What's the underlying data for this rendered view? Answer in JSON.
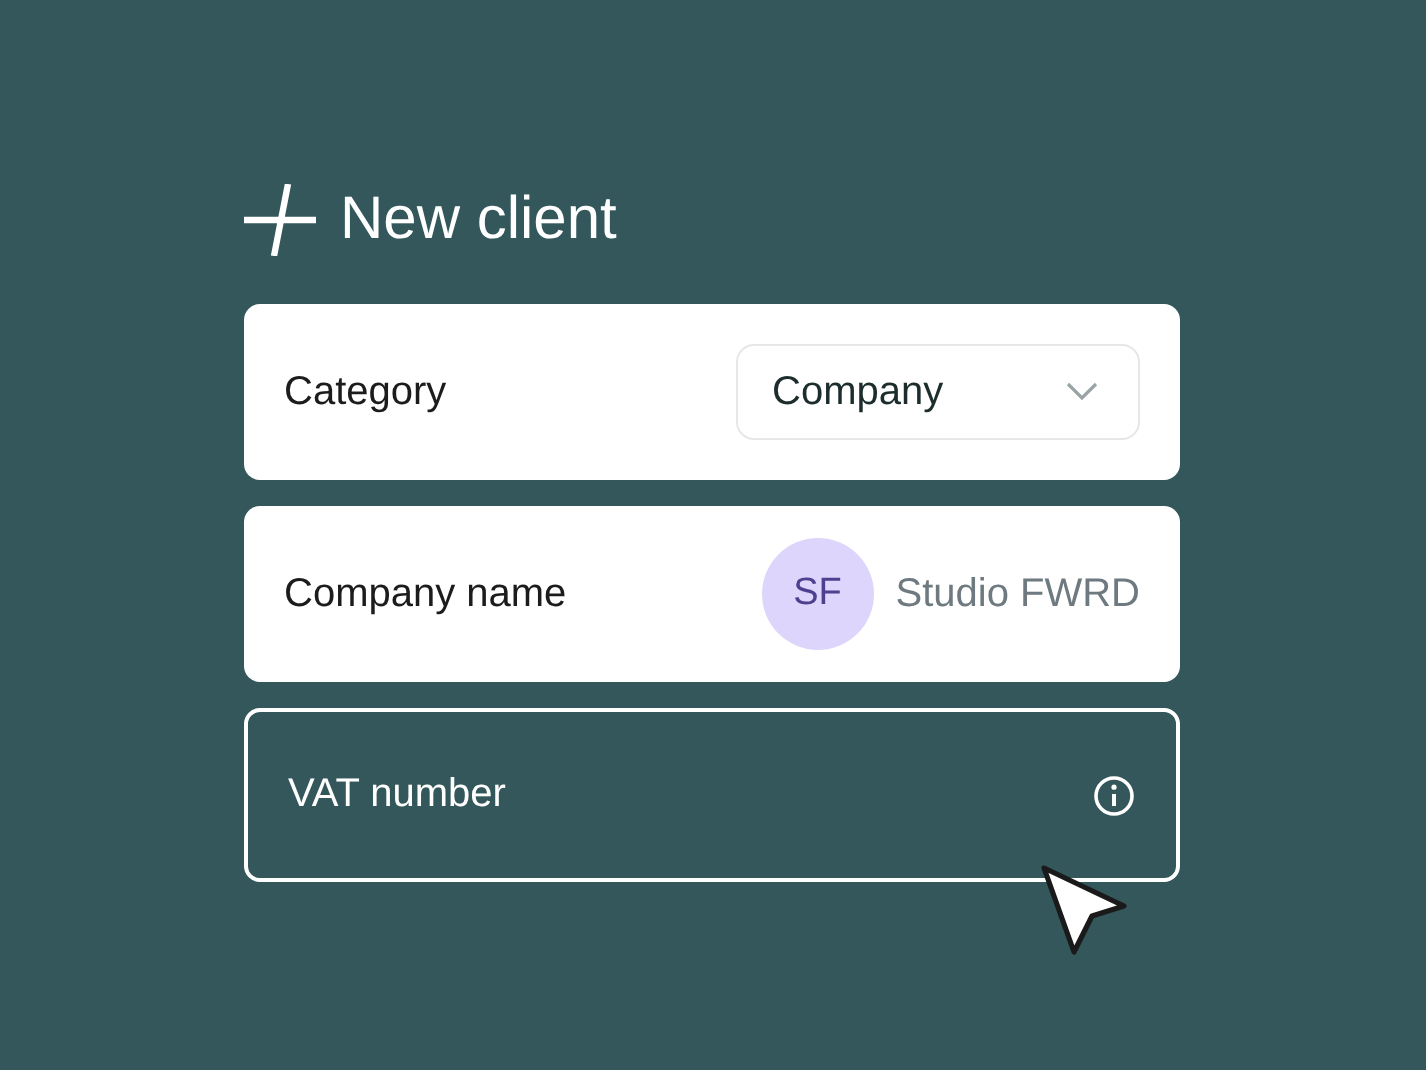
{
  "title": "New client",
  "fields": [
    {
      "kind": "select",
      "label": "Category",
      "value": "Company"
    },
    {
      "kind": "avatar",
      "label": "Company name",
      "initials": "SF",
      "value": "Studio FWRD"
    },
    {
      "kind": "info",
      "label": "VAT number"
    }
  ]
}
